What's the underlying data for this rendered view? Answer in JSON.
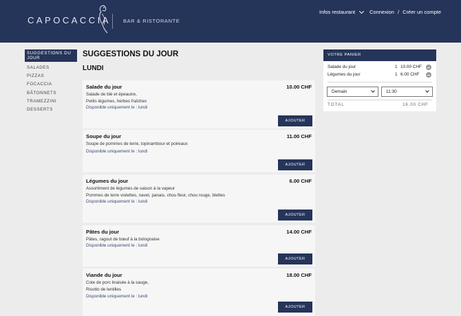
{
  "header": {
    "logo_text": "CAPOCACCIA",
    "tagline": "BAR & RISTORANTE",
    "info_menu": "Infos restaurant",
    "login": "Connexion",
    "separator": "/",
    "register": "Créer un compte"
  },
  "sidebar": {
    "items": [
      {
        "label": "SUGGESTIONS DU JOUR"
      },
      {
        "label": "SALADES"
      },
      {
        "label": "PIZZAS"
      },
      {
        "label": "FOCACCIA"
      },
      {
        "label": "BÂTONNETS"
      },
      {
        "label": "TRAMEZZINI"
      },
      {
        "label": "DESSERTS"
      }
    ]
  },
  "main": {
    "title": "SUGGESTIONS DU JOUR",
    "day": "LUNDI",
    "add_label": "AJOUTER",
    "items": [
      {
        "name": "Salade du jour",
        "price": "10.00 CHF",
        "desc": [
          "Salade de blé et épeautre,",
          "Petits légumes, herbes fraîches"
        ],
        "avail": "Disponible uniquement le : lundi"
      },
      {
        "name": "Soupe du jour",
        "price": "11.00 CHF",
        "desc": [
          "Soupe de pommes de terre, topinambour et poireaux"
        ],
        "avail": "Disponible uniquement le : lundi"
      },
      {
        "name": "Légumes du jour",
        "price": "6.00 CHF",
        "desc": [
          "Assortiment de légumes de saison à la vapeur",
          "Pommes de terre violettes, navet, panais, chou fleur, chou rouge, blettes"
        ],
        "avail": "Disponible uniquement le : lundi"
      },
      {
        "name": "Pâtes du jour",
        "price": "14.00 CHF",
        "desc": [
          "Pâtes, ragout de bœuf à la bolognaise"
        ],
        "avail": "Disponible uniquement le : lundi"
      },
      {
        "name": "Viande du jour",
        "price": "18.00 CHF",
        "desc": [
          "Cote de porc braisée à la sauge,",
          "Risotto de lentilles"
        ],
        "avail": "Disponible uniquement le : lundi"
      }
    ]
  },
  "cart": {
    "title": "VOTRE PANIER",
    "items": [
      {
        "name": "Salade du jour",
        "qty": "1",
        "price": "10.00 CHF"
      },
      {
        "name": "Légumes du jour",
        "qty": "1",
        "price": "6.00 CHF"
      }
    ],
    "day_select": "Demain",
    "time_select": "11:30",
    "total_label": "TOTAL",
    "total_value": "16.00 CHF"
  },
  "colors": {
    "brand_navy": "#253459",
    "background": "#ececec",
    "card": "#f6f6f6"
  }
}
